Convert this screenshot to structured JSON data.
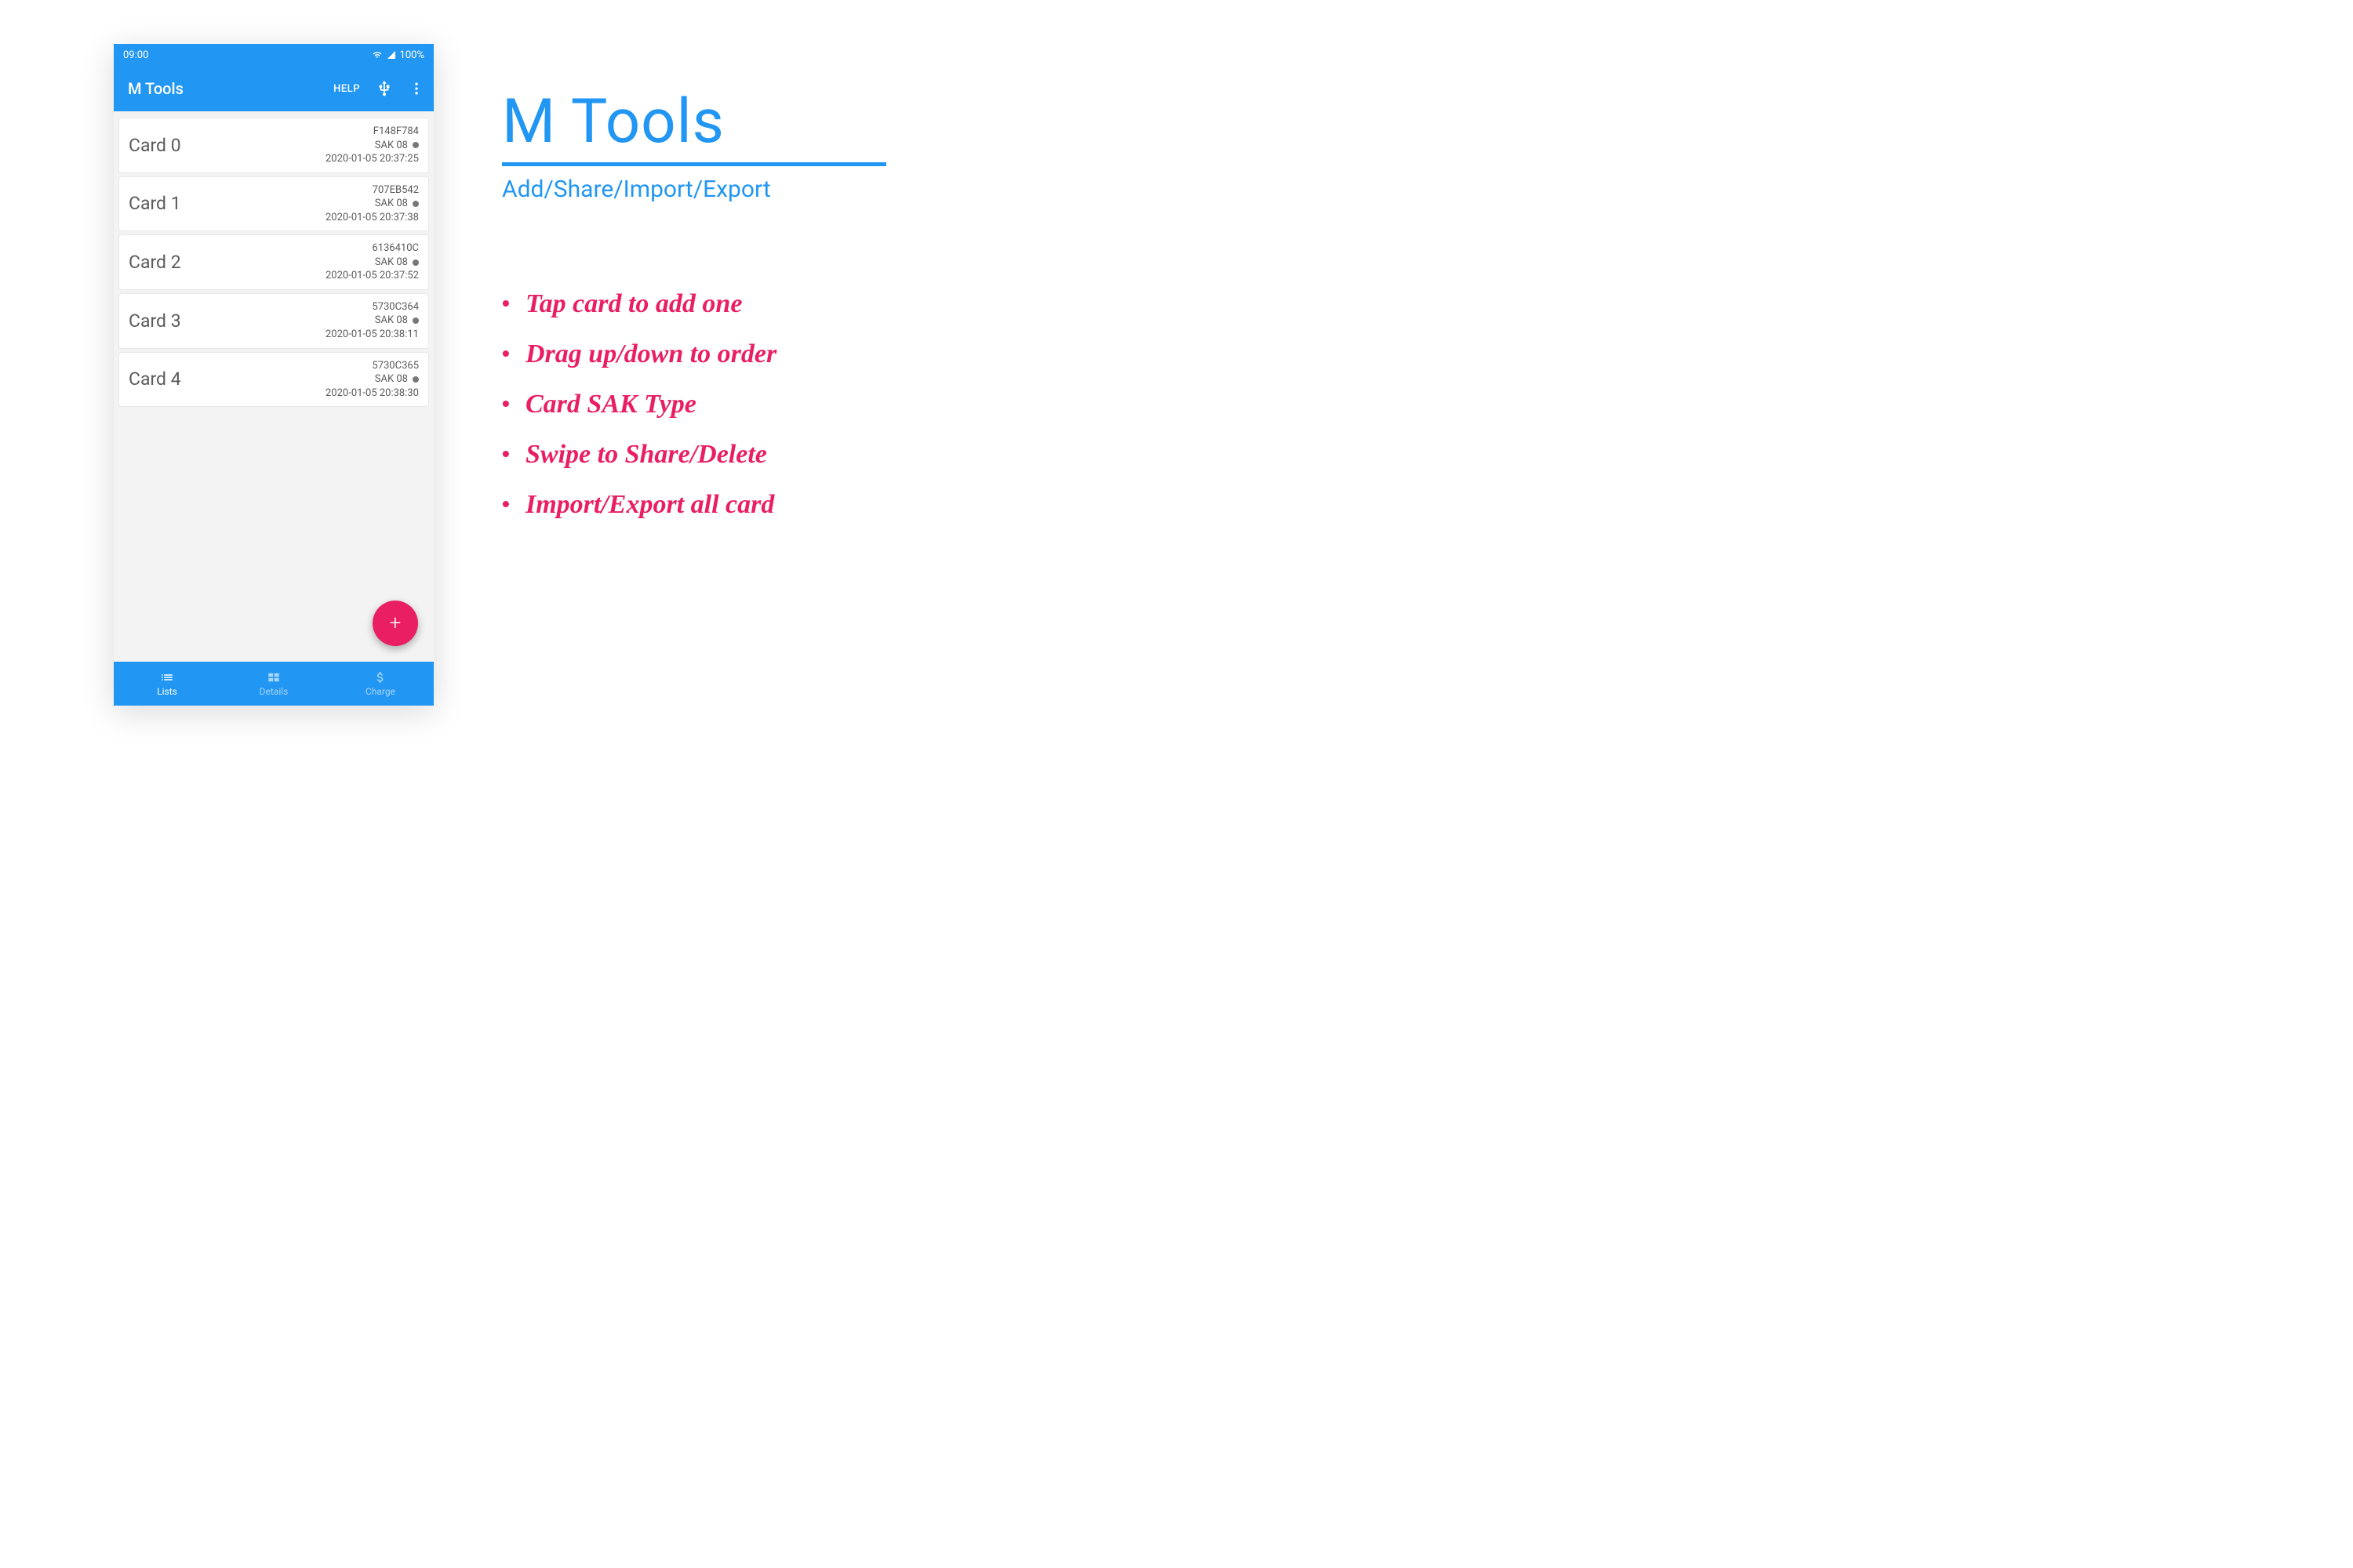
{
  "status": {
    "time": "09:00",
    "battery": "100%"
  },
  "appbar": {
    "title": "M Tools",
    "help": "HELP"
  },
  "cards": [
    {
      "name": "Card 0",
      "id": "F148F784",
      "sak": "SAK 08",
      "ts": "2020-01-05 20:37:25"
    },
    {
      "name": "Card 1",
      "id": "707EB542",
      "sak": "SAK 08",
      "ts": "2020-01-05 20:37:38"
    },
    {
      "name": "Card 2",
      "id": "6136410C",
      "sak": "SAK 08",
      "ts": "2020-01-05 20:37:52"
    },
    {
      "name": "Card 3",
      "id": "5730C364",
      "sak": "SAK 08",
      "ts": "2020-01-05 20:38:11"
    },
    {
      "name": "Card 4",
      "id": "5730C365",
      "sak": "SAK 08",
      "ts": "2020-01-05 20:38:30"
    }
  ],
  "fab": {
    "label": "+"
  },
  "nav": {
    "lists": "Lists",
    "details": "Details",
    "charge": "Charge"
  },
  "promo": {
    "title": "M Tools",
    "subtitle": "Add/Share/Import/Export",
    "bullets": [
      "Tap card to add one",
      "Drag up/down to order",
      "Card SAK Type",
      "Swipe to Share/Delete",
      "Import/Export all card"
    ]
  }
}
